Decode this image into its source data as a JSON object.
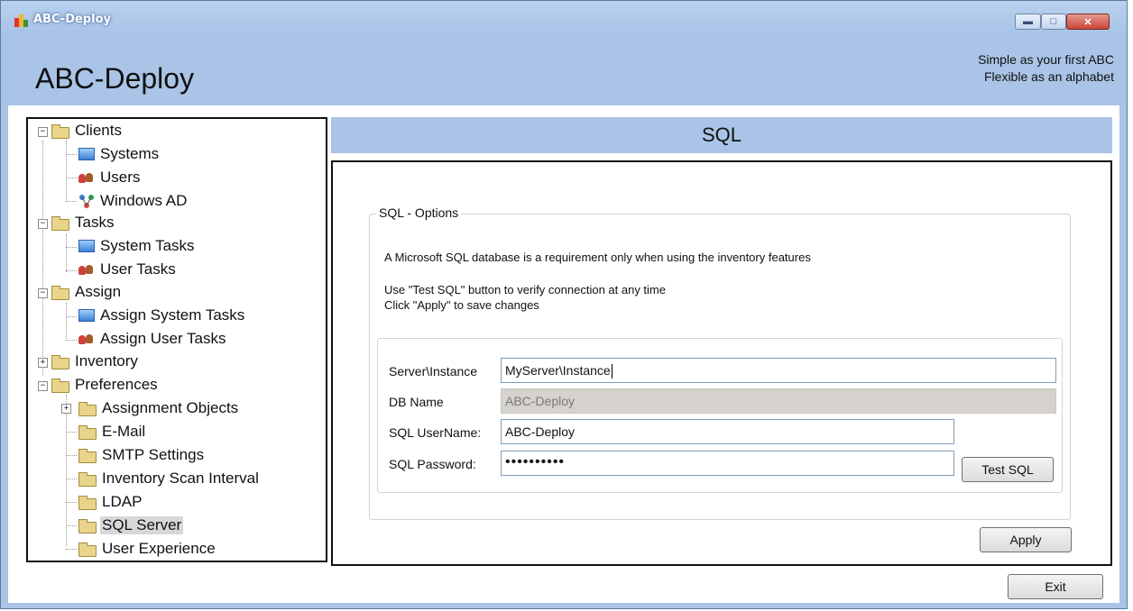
{
  "window": {
    "title": "ABC-Deploy",
    "minimize_icon": "minimize-icon",
    "maximize_icon": "maximize-icon",
    "close_icon": "close-icon"
  },
  "header": {
    "app_name": "ABC-Deploy",
    "tagline_line1": "Simple as your first ABC",
    "tagline_line2": "Flexible as an alphabet"
  },
  "tree": {
    "items": [
      {
        "label": "Clients",
        "icon": "folder-open-icon"
      },
      {
        "label": "Systems",
        "icon": "computer-icon"
      },
      {
        "label": "Users",
        "icon": "users-icon"
      },
      {
        "label": "Windows AD",
        "icon": "network-icon"
      },
      {
        "label": "Tasks",
        "icon": "folder-open-icon"
      },
      {
        "label": "System Tasks",
        "icon": "computer-icon"
      },
      {
        "label": "User Tasks",
        "icon": "users-icon"
      },
      {
        "label": "Assign",
        "icon": "folder-open-icon"
      },
      {
        "label": "Assign System Tasks",
        "icon": "computer-icon"
      },
      {
        "label": "Assign User Tasks",
        "icon": "users-icon"
      },
      {
        "label": "Inventory",
        "icon": "folder-icon"
      },
      {
        "label": "Preferences",
        "icon": "folder-open-icon"
      },
      {
        "label": "Assignment Objects",
        "icon": "folder-icon"
      },
      {
        "label": "E-Mail",
        "icon": "folder-icon"
      },
      {
        "label": "SMTP Settings",
        "icon": "folder-icon"
      },
      {
        "label": "Inventory Scan Interval",
        "icon": "folder-icon"
      },
      {
        "label": "LDAP",
        "icon": "folder-icon"
      },
      {
        "label": "SQL Server",
        "icon": "folder-open-icon",
        "selected": true
      },
      {
        "label": "User Experience",
        "icon": "folder-icon"
      }
    ]
  },
  "section": {
    "title": "SQL"
  },
  "sql_options": {
    "group_title": "SQL - Options",
    "info_line1": "A Microsoft SQL database is a requirement only when using the inventory features",
    "info_line2": "Use \"Test SQL\" button to verify connection at any time",
    "info_line3": "Click \"Apply\" to save changes",
    "server_label": "Server\\Instance",
    "server_value": "MyServer\\Instance",
    "db_label": "DB Name",
    "db_value": "ABC-Deploy",
    "user_label": "SQL UserName:",
    "user_value": "ABC-Deploy",
    "password_label": "SQL Password:",
    "password_value": "••••••••••",
    "test_button": "Test SQL"
  },
  "buttons": {
    "apply": "Apply",
    "exit": "Exit"
  }
}
